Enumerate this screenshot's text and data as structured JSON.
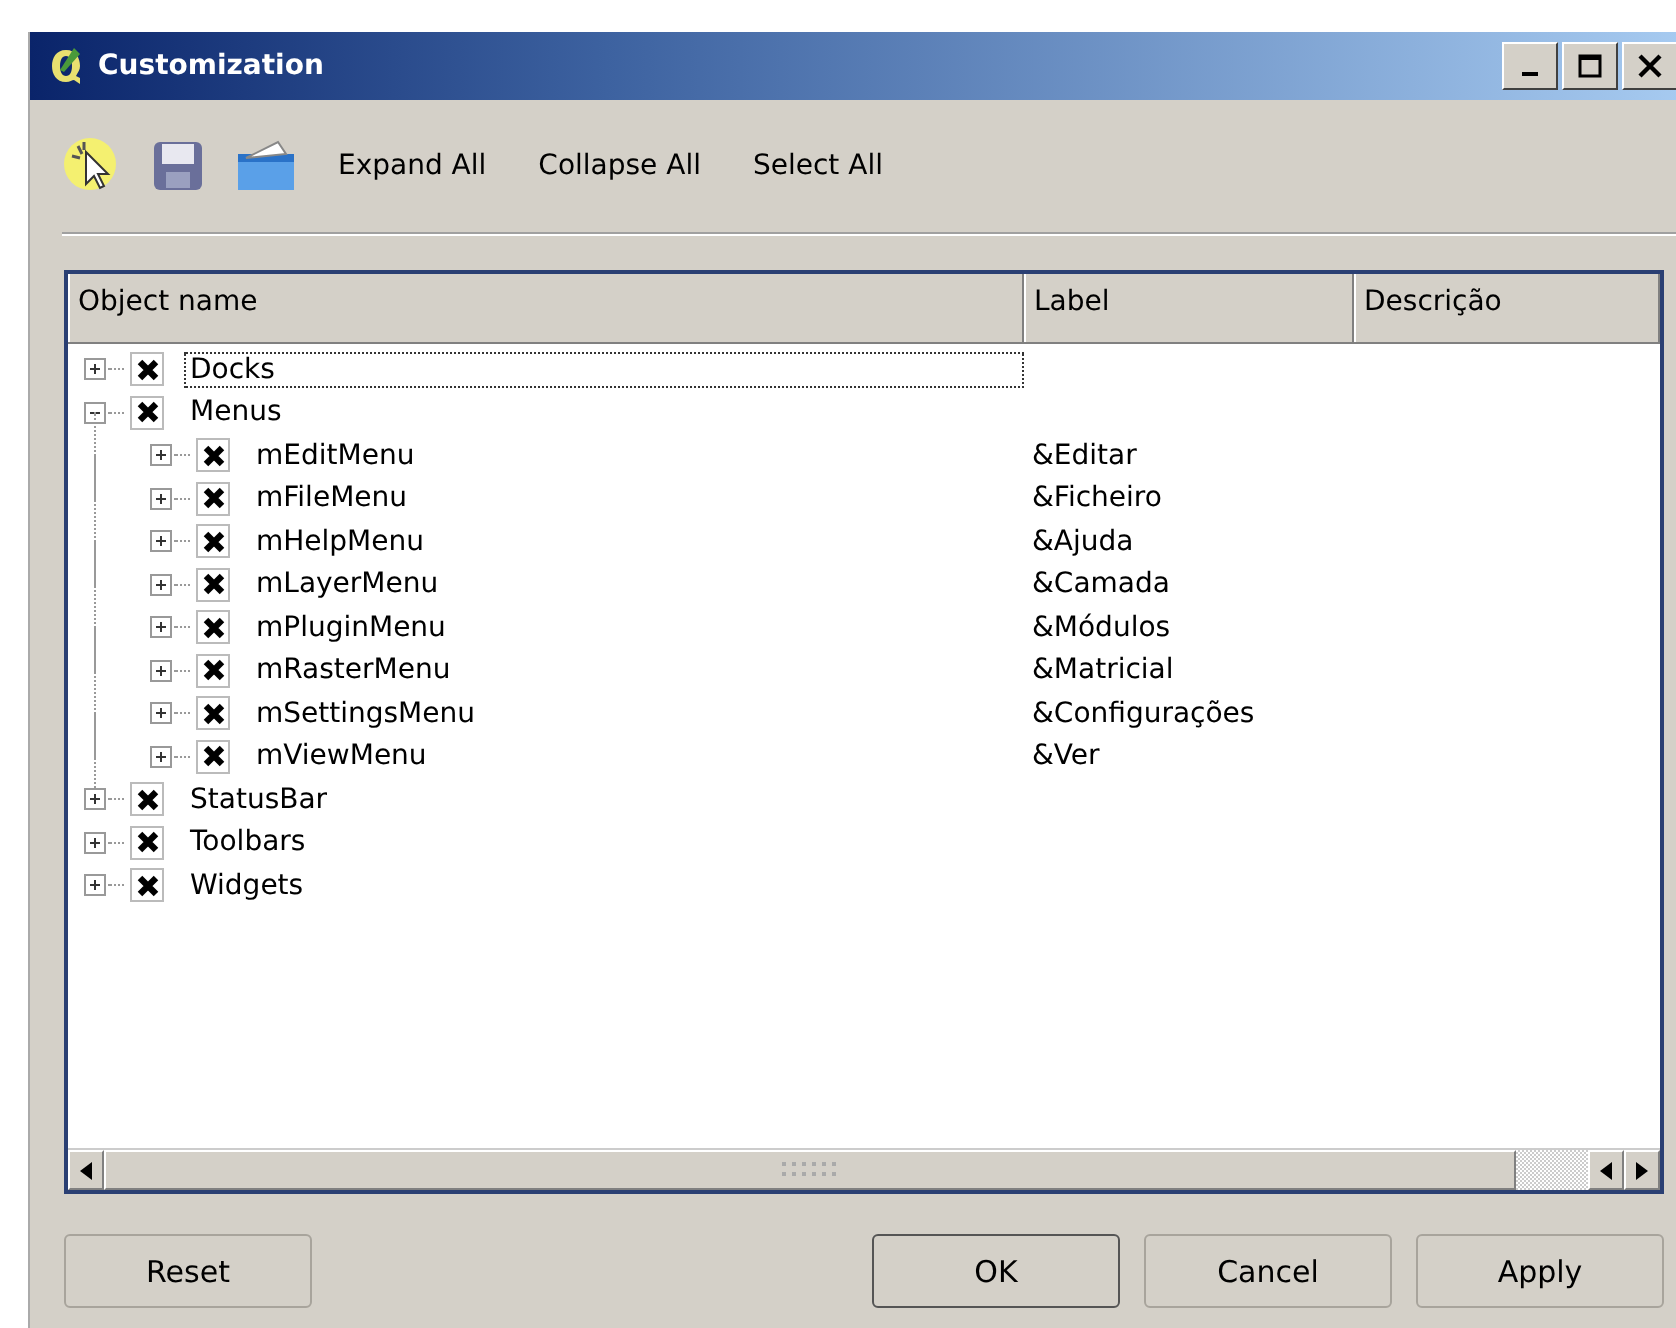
{
  "window": {
    "title": "Customization"
  },
  "toolbar": {
    "buttons": [
      "Expand All",
      "Collapse All",
      "Select All"
    ]
  },
  "tree": {
    "columns": [
      "Object name",
      "Label",
      "Descrição"
    ],
    "items": [
      {
        "name": "Docks",
        "checked": true,
        "expanded": false,
        "focused": true
      },
      {
        "name": "Menus",
        "checked": true,
        "expanded": true,
        "focused": false,
        "children": [
          {
            "name": "mEditMenu",
            "label": "&Editar",
            "checked": true,
            "expanded": false,
            "focused": false
          },
          {
            "name": "mFileMenu",
            "label": "&Ficheiro",
            "checked": true,
            "expanded": false,
            "focused": false
          },
          {
            "name": "mHelpMenu",
            "label": "&Ajuda",
            "checked": true,
            "expanded": false,
            "focused": false
          },
          {
            "name": "mLayerMenu",
            "label": "&Camada",
            "checked": true,
            "expanded": false,
            "focused": false
          },
          {
            "name": "mPluginMenu",
            "label": "&Módulos",
            "checked": true,
            "expanded": false,
            "focused": false
          },
          {
            "name": "mRasterMenu",
            "label": "&Matricial",
            "checked": true,
            "expanded": false,
            "focused": false
          },
          {
            "name": "mSettingsMenu",
            "label": "&Configurações",
            "checked": true,
            "expanded": false,
            "focused": false
          },
          {
            "name": "mViewMenu",
            "label": "&Ver",
            "checked": true,
            "expanded": false,
            "focused": false
          }
        ]
      },
      {
        "name": "StatusBar",
        "checked": true,
        "expanded": false,
        "focused": false
      },
      {
        "name": "Toolbars",
        "checked": true,
        "expanded": false,
        "focused": false
      },
      {
        "name": "Widgets",
        "checked": true,
        "expanded": false,
        "focused": false
      }
    ]
  },
  "buttons": {
    "reset": "Reset",
    "ok": "OK",
    "cancel": "Cancel",
    "apply": "Apply"
  }
}
